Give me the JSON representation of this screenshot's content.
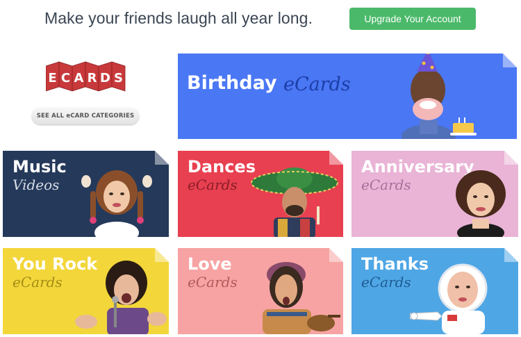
{
  "header": {
    "tagline": "Make your friends laugh all year long.",
    "upgrade_label": "Upgrade Your Account"
  },
  "sidebar": {
    "logo_text": "ECARDS",
    "see_all_label": "SEE ALL eCARD CATEGORIES"
  },
  "cards": {
    "birthday": {
      "title": "Birthday",
      "subtitle": "eCards"
    },
    "music": {
      "title": "Music",
      "subtitle": "Videos"
    },
    "dances": {
      "title": "Dances",
      "subtitle": "eCards"
    },
    "anniversary": {
      "title": "Anniversary",
      "subtitle": "eCards"
    },
    "you_rock": {
      "title": "You Rock",
      "subtitle": "eCards"
    },
    "love": {
      "title": "Love",
      "subtitle": "eCards"
    },
    "thanks": {
      "title": "Thanks",
      "subtitle": "eCards"
    }
  },
  "colors": {
    "upgrade_button": "#4bb96a",
    "birthday": "#4a77f4",
    "music": "#25395a",
    "dances": "#e84050",
    "anniversary": "#e9b4d6",
    "you_rock": "#f3d63a",
    "love": "#f7a3a3",
    "thanks": "#4fa6e5",
    "logo_red": "#c8393b"
  }
}
